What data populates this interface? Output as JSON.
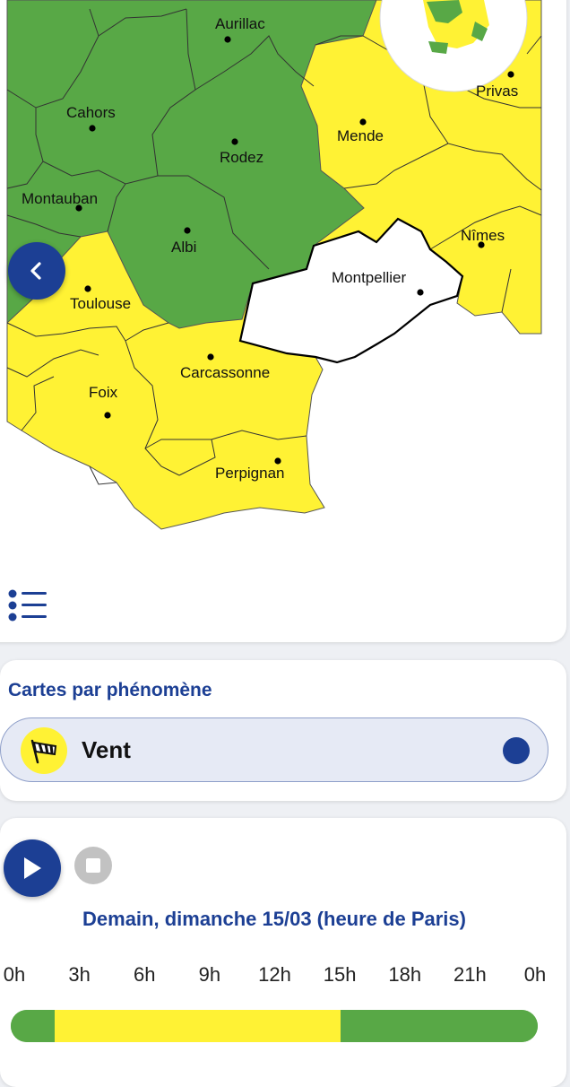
{
  "map": {
    "cities": [
      {
        "name": "Aurillac"
      },
      {
        "name": "Cahors"
      },
      {
        "name": "Mende"
      },
      {
        "name": "Privas"
      },
      {
        "name": "Rodez"
      },
      {
        "name": "Montauban"
      },
      {
        "name": "Albi"
      },
      {
        "name": "Nîmes"
      },
      {
        "name": "Montpellier"
      },
      {
        "name": "Toulouse"
      },
      {
        "name": "Carcassonne"
      },
      {
        "name": "Foix"
      },
      {
        "name": "Perpignan"
      }
    ],
    "level_colors": {
      "green": "#58a846",
      "yellow": "#fff234"
    }
  },
  "phenomenon": {
    "title": "Cartes par phénomène",
    "selected": "Vent",
    "icon": "windsock-icon"
  },
  "timeline": {
    "date": "Demain, dimanche 15/03 (heure de Paris)",
    "hours": [
      "0h",
      "3h",
      "6h",
      "9h",
      "12h",
      "15h",
      "18h",
      "21h",
      "0h"
    ],
    "segments": [
      {
        "level": "green",
        "from_hour": 0,
        "to_hour": 2
      },
      {
        "level": "yellow",
        "from_hour": 2,
        "to_hour": 15
      },
      {
        "level": "green",
        "from_hour": 15,
        "to_hour": 24
      }
    ]
  },
  "colors": {
    "accent": "#1c3f94",
    "green": "#58a846",
    "yellow": "#fff234"
  }
}
